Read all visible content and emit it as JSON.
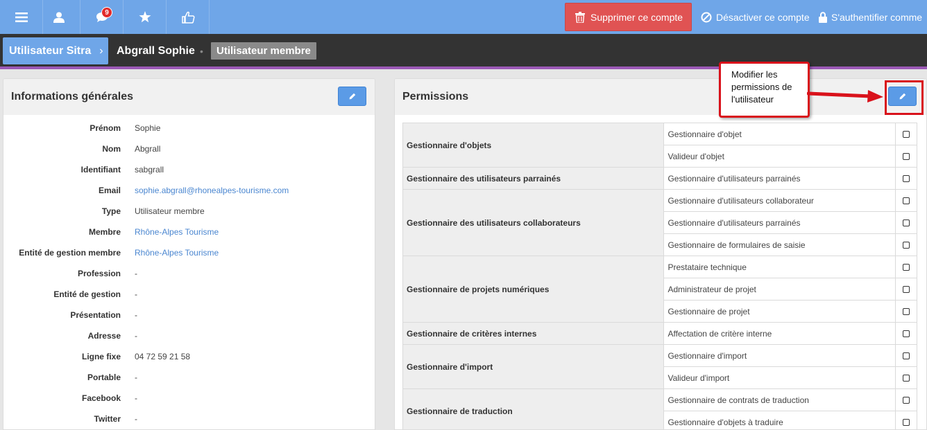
{
  "topbar": {
    "notifications_count": "9",
    "delete_label": "Supprimer ce compte",
    "deactivate_label": "Désactiver ce compte",
    "authenticate_label": "S'authentifier comme"
  },
  "breadcrumb": {
    "first": "Utilisateur Sitra",
    "name": "Abgrall Sophie",
    "separator": "•",
    "role": "Utilisateur membre"
  },
  "general": {
    "title": "Informations générales",
    "fields": [
      {
        "label": "Prénom",
        "value": "Sophie"
      },
      {
        "label": "Nom",
        "value": "Abgrall"
      },
      {
        "label": "Identifiant",
        "value": "sabgrall"
      },
      {
        "label": "Email",
        "value": "sophie.abgrall@rhonealpes-tourisme.com"
      },
      {
        "label": "Type",
        "value": "Utilisateur membre"
      },
      {
        "label": "Membre",
        "value": "Rhône-Alpes Tourisme"
      },
      {
        "label": "Entité de gestion membre",
        "value": "Rhône-Alpes Tourisme"
      },
      {
        "label": "Profession",
        "value": "-"
      },
      {
        "label": "Entité de gestion",
        "value": "-"
      },
      {
        "label": "Présentation",
        "value": "-"
      },
      {
        "label": "Adresse",
        "value": "-"
      },
      {
        "label": "Ligne fixe",
        "value": "04 72 59 21 58"
      },
      {
        "label": "Portable",
        "value": "-"
      },
      {
        "label": "Facebook",
        "value": "-"
      },
      {
        "label": "Twitter",
        "value": "-"
      }
    ]
  },
  "permissions": {
    "title": "Permissions",
    "groups": [
      {
        "name": "Gestionnaire d'objets",
        "roles": [
          "Gestionnaire d'objet",
          "Valideur d'objet"
        ]
      },
      {
        "name": "Gestionnaire des utilisateurs parrainés",
        "roles": [
          "Gestionnaire d'utilisateurs parrainés"
        ]
      },
      {
        "name": "Gestionnaire des utilisateurs collaborateurs",
        "roles": [
          "Gestionnaire d'utilisateurs collaborateur",
          "Gestionnaire d'utilisateurs parrainés",
          "Gestionnaire de formulaires de saisie"
        ]
      },
      {
        "name": "Gestionnaire de projets numériques",
        "roles": [
          "Prestataire technique",
          "Administrateur de projet",
          "Gestionnaire de projet"
        ]
      },
      {
        "name": "Gestionnaire de critères internes",
        "roles": [
          "Affectation de critère interne"
        ]
      },
      {
        "name": "Gestionnaire d'import",
        "roles": [
          "Gestionnaire d'import",
          "Valideur d'import"
        ]
      },
      {
        "name": "Gestionnaire de traduction",
        "roles": [
          "Gestionnaire de contrats de traduction",
          "Gestionnaire d'objets à traduire"
        ]
      }
    ]
  },
  "callout": {
    "line1": "Modifier les",
    "line2": "permissions de",
    "line3": "l'utilisateur"
  },
  "colors": {
    "topbar": "#6fa6e8",
    "delete": "#e05353",
    "accent_line": "#9b59b6",
    "link": "#4a86d0",
    "callout_border": "#d9121b"
  }
}
